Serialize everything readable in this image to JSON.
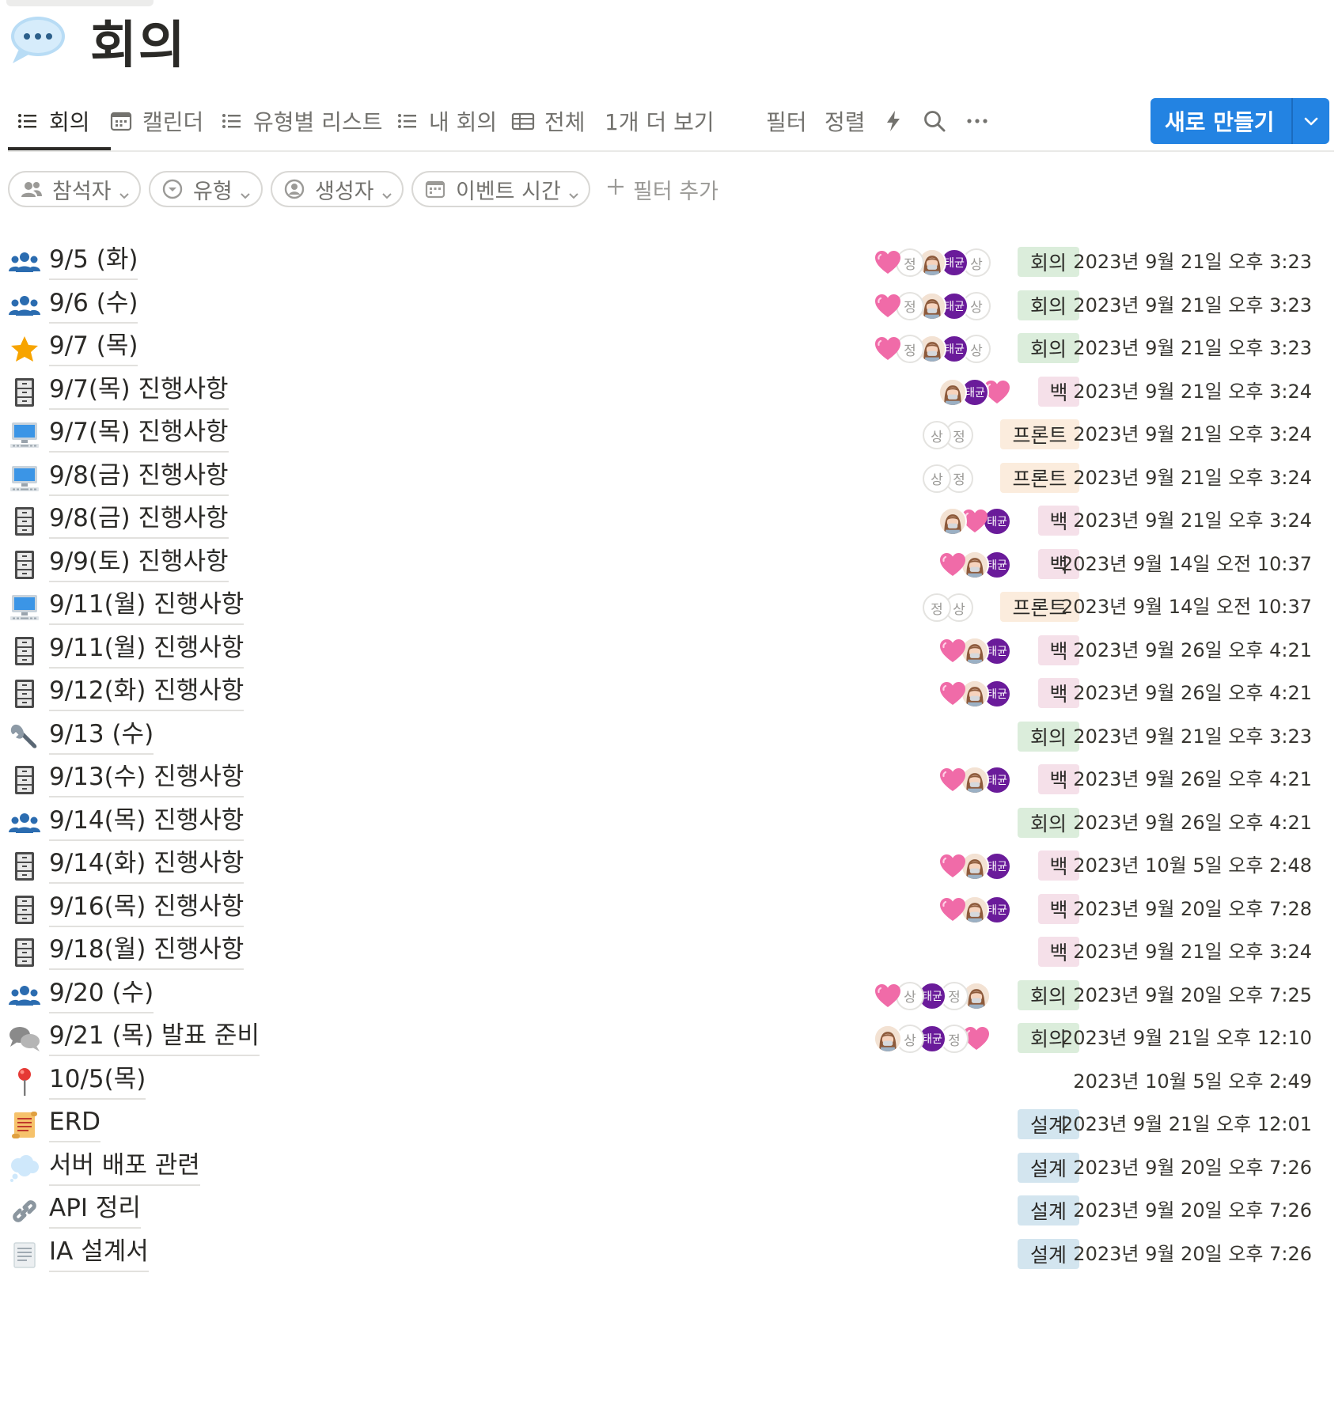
{
  "page": {
    "title": "회의",
    "title_icon": "speech-balloon-icon"
  },
  "tabs": [
    {
      "label": "회의",
      "icon": "list-icon",
      "active": true
    },
    {
      "label": "캘린더",
      "icon": "calendar-icon"
    },
    {
      "label": "유형별 리스트",
      "icon": "list-icon"
    },
    {
      "label": "내 회의",
      "icon": "list-icon"
    },
    {
      "label": "전체",
      "icon": "table-icon"
    },
    {
      "label": "1개 더 보기"
    }
  ],
  "toolbar": {
    "filter_label": "필터",
    "sort_label": "정렬",
    "automation_icon": "lightning-icon",
    "search_icon": "search-icon",
    "more_icon": "more-icon",
    "new_label": "새로 만들기",
    "accent": "#2383e2"
  },
  "filters": [
    {
      "label": "참석자",
      "icon": "people-icon"
    },
    {
      "label": "유형",
      "icon": "select-icon"
    },
    {
      "label": "생성자",
      "icon": "person-circle-icon"
    },
    {
      "label": "이벤트 시간",
      "icon": "calendar-icon"
    }
  ],
  "add_filter_label": "필터 추가",
  "rows": [
    {
      "icon": "people-icon",
      "title": "9/5 (화)",
      "attendees": [
        "heart",
        "정",
        "girl",
        "태균",
        "상"
      ],
      "type": "회의",
      "type_color": "#dbeddb",
      "created": "2023년 9월 21일 오후 3:23"
    },
    {
      "icon": "people-icon",
      "title": "9/6 (수)",
      "attendees": [
        "heart",
        "정",
        "girl",
        "태균",
        "상"
      ],
      "type": "회의",
      "type_color": "#dbeddb",
      "created": "2023년 9월 21일 오후 3:23"
    },
    {
      "icon": "star-icon",
      "title": "9/7 (목)",
      "attendees": [
        "heart",
        "정",
        "girl",
        "태균",
        "상"
      ],
      "type": "회의",
      "type_color": "#dbeddb",
      "created": "2023년 9월 21일 오후 3:23"
    },
    {
      "icon": "file-cabinet-icon",
      "title": "9/7(목) 진행사항",
      "attendees": [
        "girl",
        "태균",
        "heart"
      ],
      "type": "백",
      "type_color": "#f5e0e9",
      "created": "2023년 9월 21일 오후 3:24"
    },
    {
      "icon": "computer-icon",
      "title": "9/7(목) 진행사항",
      "attendees": [
        "상",
        "정"
      ],
      "type": "프론트",
      "type_color": "#fbecdd",
      "created": "2023년 9월 21일 오후 3:24"
    },
    {
      "icon": "computer-icon",
      "title": "9/8(금) 진행사항",
      "attendees": [
        "상",
        "정"
      ],
      "type": "프론트",
      "type_color": "#fbecdd",
      "created": "2023년 9월 21일 오후 3:24"
    },
    {
      "icon": "file-cabinet-icon",
      "title": "9/8(금) 진행사항",
      "attendees": [
        "girl",
        "heart",
        "태균"
      ],
      "type": "백",
      "type_color": "#f5e0e9",
      "created": "2023년 9월 21일 오후 3:24"
    },
    {
      "icon": "file-cabinet-icon",
      "title": "9/9(토) 진행사항",
      "attendees": [
        "heart",
        "girl",
        "태균"
      ],
      "type": "백",
      "type_color": "#f5e0e9",
      "created": "2023년 9월 14일 오전 10:37"
    },
    {
      "icon": "computer-icon",
      "title": "9/11(월) 진행사항",
      "attendees": [
        "정",
        "상"
      ],
      "type": "프론트",
      "type_color": "#fbecdd",
      "created": "2023년 9월 14일 오전 10:37"
    },
    {
      "icon": "file-cabinet-icon",
      "title": "9/11(월) 진행사항",
      "attendees": [
        "heart",
        "girl",
        "태균"
      ],
      "type": "백",
      "type_color": "#f5e0e9",
      "created": "2023년 9월 26일 오후 4:21"
    },
    {
      "icon": "file-cabinet-icon",
      "title": "9/12(화) 진행사항",
      "attendees": [
        "heart",
        "girl",
        "태균"
      ],
      "type": "백",
      "type_color": "#f5e0e9",
      "created": "2023년 9월 26일 오후 4:21"
    },
    {
      "icon": "wrench-icon",
      "title": "9/13 (수)",
      "attendees": [],
      "type": "회의",
      "type_color": "#dbeddb",
      "created": "2023년 9월 21일 오후 3:23"
    },
    {
      "icon": "file-cabinet-icon",
      "title": "9/13(수) 진행사항",
      "attendees": [
        "heart",
        "girl",
        "태균"
      ],
      "type": "백",
      "type_color": "#f5e0e9",
      "created": "2023년 9월 26일 오후 4:21"
    },
    {
      "icon": "people-icon",
      "title": "9/14(목) 진행사항",
      "attendees": [],
      "type": "회의",
      "type_color": "#dbeddb",
      "created": "2023년 9월 26일 오후 4:21"
    },
    {
      "icon": "file-cabinet-icon",
      "title": "9/14(화) 진행사항",
      "attendees": [
        "heart",
        "girl",
        "태균"
      ],
      "type": "백",
      "type_color": "#f5e0e9",
      "created": "2023년 10월 5일 오후 2:48"
    },
    {
      "icon": "file-cabinet-icon",
      "title": "9/16(목) 진행사항",
      "attendees": [
        "heart",
        "girl",
        "태균"
      ],
      "type": "백",
      "type_color": "#f5e0e9",
      "created": "2023년 9월 20일 오후 7:28"
    },
    {
      "icon": "file-cabinet-icon",
      "title": "9/18(월) 진행사항",
      "attendees": [],
      "type": "백",
      "type_color": "#f5e0e9",
      "created": "2023년 9월 21일 오후 3:24"
    },
    {
      "icon": "people-icon",
      "title": "9/20 (수)",
      "attendees": [
        "heart",
        "상",
        "태균",
        "정",
        "girl"
      ],
      "type": "회의",
      "type_color": "#dbeddb",
      "created": "2023년 9월 20일 오후 7:25"
    },
    {
      "icon": "speech-bubbles-icon",
      "title": "9/21 (목) 발표 준비",
      "attendees": [
        "girl",
        "상",
        "태균",
        "정",
        "heart"
      ],
      "type": "회의",
      "type_color": "#dbeddb",
      "created": "2023년 9월 21일 오후 12:10"
    },
    {
      "icon": "pushpin-icon",
      "title": "10/5(목)",
      "attendees": [],
      "type": "",
      "type_color": "",
      "created": "2023년 10월 5일 오후 2:49"
    },
    {
      "icon": "scroll-icon",
      "title": "ERD",
      "attendees": [],
      "type": "설계",
      "type_color": "#d3e5ef",
      "created": "2023년 9월 21일 오후 12:01"
    },
    {
      "icon": "thought-bubble-icon",
      "title": "서버 배포 관련",
      "attendees": [],
      "type": "설계",
      "type_color": "#d3e5ef",
      "created": "2023년 9월 20일 오후 7:26"
    },
    {
      "icon": "link-icon",
      "title": "API 정리",
      "attendees": [],
      "type": "설계",
      "type_color": "#d3e5ef",
      "created": "2023년 9월 20일 오후 7:26"
    },
    {
      "icon": "page-icon",
      "title": "IA 설계서",
      "attendees": [],
      "type": "설계",
      "type_color": "#d3e5ef",
      "created": "2023년 9월 20일 오후 7:26"
    }
  ]
}
